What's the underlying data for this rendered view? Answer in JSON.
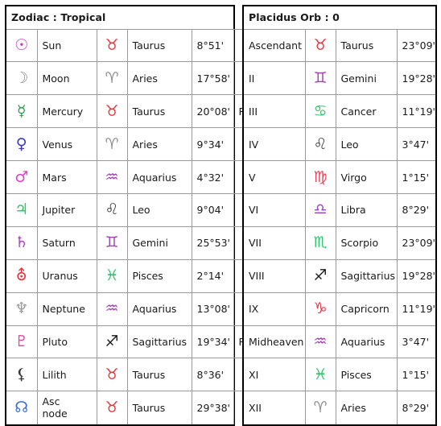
{
  "left_table": {
    "header": "Zodiac : Tropical",
    "rows": [
      {
        "glyph": "☉",
        "glyph_color": "#cc33cc",
        "body": "Sun",
        "sign_glyph": "♉",
        "sign_color": "#e8333a",
        "sign": "Taurus",
        "degree": "8°51'",
        "retro": ""
      },
      {
        "glyph": "☽",
        "glyph_color": "#8c8c8c",
        "body": "Moon",
        "sign_glyph": "♈",
        "sign_color": "#8c8c8c",
        "sign": "Aries",
        "degree": "17°58'",
        "retro": ""
      },
      {
        "glyph": "☿",
        "glyph_color": "#2a9d4a",
        "body": "Mercury",
        "sign_glyph": "♉",
        "sign_color": "#e8333a",
        "sign": "Taurus",
        "degree": "20°08'",
        "retro": "R"
      },
      {
        "glyph": "♀",
        "glyph_color": "#3b3bc4",
        "body": "Venus",
        "sign_glyph": "♈",
        "sign_color": "#8c8c8c",
        "sign": "Aries",
        "degree": "9°34'",
        "retro": ""
      },
      {
        "glyph": "♂",
        "glyph_color": "#e043c8",
        "body": "Mars",
        "sign_glyph": "♒",
        "sign_color": "#a23fb0",
        "sign": "Aquarius",
        "degree": "4°32'",
        "retro": ""
      },
      {
        "glyph": "♃",
        "glyph_color": "#2fc46b",
        "body": "Jupiter",
        "sign_glyph": "♌",
        "sign_color": "#4a4a4a",
        "sign": "Leo",
        "degree": "9°04'",
        "retro": ""
      },
      {
        "glyph": "♄",
        "glyph_color": "#b03fd0",
        "body": "Saturn",
        "sign_glyph": "♊",
        "sign_color": "#a23fb0",
        "sign": "Gemini",
        "degree": "25°53'",
        "retro": ""
      },
      {
        "glyph": "⛢",
        "glyph_color": "#e8333a",
        "body": "Uranus",
        "sign_glyph": "♓",
        "sign_color": "#2fc46b",
        "sign": "Pisces",
        "degree": "2°14'",
        "retro": ""
      },
      {
        "glyph": "♆",
        "glyph_color": "#9a9a9a",
        "body": "Neptune",
        "sign_glyph": "♒",
        "sign_color": "#a23fb0",
        "sign": "Aquarius",
        "degree": "13°08'",
        "retro": ""
      },
      {
        "glyph": "♇",
        "glyph_color": "#ef3fa0",
        "body": "Pluto",
        "sign_glyph": "♐",
        "sign_color": "#1a1a1a",
        "sign": "Sagittarius",
        "degree": "19°34'",
        "retro": "R"
      },
      {
        "glyph": "⚸",
        "glyph_color": "#3a3a3a",
        "body": "Lilith",
        "sign_glyph": "♉",
        "sign_color": "#e8333a",
        "sign": "Taurus",
        "degree": "8°36'",
        "retro": ""
      },
      {
        "glyph": "☊",
        "glyph_color": "#3b6fd4",
        "body": "Asc node",
        "sign_glyph": "♉",
        "sign_color": "#e8333a",
        "sign": "Taurus",
        "degree": "29°38'",
        "retro": ""
      }
    ]
  },
  "right_table": {
    "header": "Placidus Orb : 0",
    "rows": [
      {
        "house": "Ascendant",
        "sign_glyph": "♉",
        "sign_color": "#e8333a",
        "sign": "Taurus",
        "degree": "23°09'"
      },
      {
        "house": "II",
        "sign_glyph": "♊",
        "sign_color": "#a23fb0",
        "sign": "Gemini",
        "degree": "19°28'"
      },
      {
        "house": "III",
        "sign_glyph": "♋",
        "sign_color": "#2fc46b",
        "sign": "Cancer",
        "degree": "11°19'"
      },
      {
        "house": "IV",
        "sign_glyph": "♌",
        "sign_color": "#4a4a4a",
        "sign": "Leo",
        "degree": "3°47'"
      },
      {
        "house": "V",
        "sign_glyph": "♍",
        "sign_color": "#e8445a",
        "sign": "Virgo",
        "degree": "1°15'"
      },
      {
        "house": "VI",
        "sign_glyph": "♎",
        "sign_color": "#9a3fc0",
        "sign": "Libra",
        "degree": "8°29'"
      },
      {
        "house": "VII",
        "sign_glyph": "♏",
        "sign_color": "#2fc46b",
        "sign": "Scorpio",
        "degree": "23°09'"
      },
      {
        "house": "VIII",
        "sign_glyph": "♐",
        "sign_color": "#1a1a1a",
        "sign": "Sagittarius",
        "degree": "19°28'"
      },
      {
        "house": "IX",
        "sign_glyph": "♑",
        "sign_color": "#e8334a",
        "sign": "Capricorn",
        "degree": "11°19'"
      },
      {
        "house": "Midheaven",
        "sign_glyph": "♒",
        "sign_color": "#a23fb0",
        "sign": "Aquarius",
        "degree": "3°47'"
      },
      {
        "house": "XI",
        "sign_glyph": "♓",
        "sign_color": "#2fc46b",
        "sign": "Pisces",
        "degree": "1°15'"
      },
      {
        "house": "XII",
        "sign_glyph": "♈",
        "sign_color": "#8c8c8c",
        "sign": "Aries",
        "degree": "8°29'"
      }
    ]
  }
}
